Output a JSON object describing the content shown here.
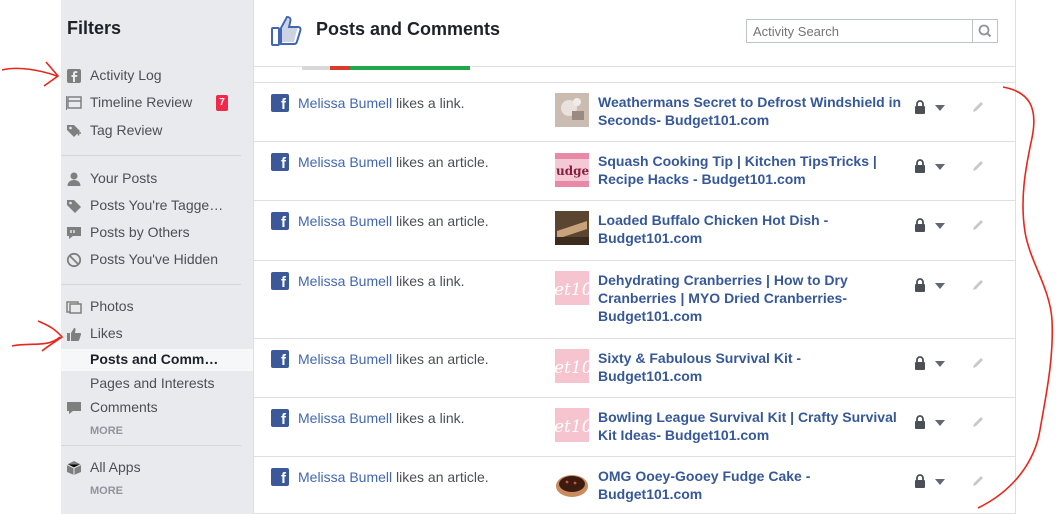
{
  "sidebar": {
    "title": "Filters",
    "groups": [
      [
        {
          "label": "Activity Log",
          "icon": "facebook-square-icon"
        },
        {
          "label": "Timeline Review",
          "icon": "timeline-review-icon",
          "badge": "7"
        },
        {
          "label": "Tag Review",
          "icon": "tag-review-icon"
        }
      ],
      [
        {
          "label": "Your Posts",
          "icon": "person-icon"
        },
        {
          "label": "Posts You're Tagged In",
          "icon": "tag-icon"
        },
        {
          "label": "Posts by Others",
          "icon": "speech-bubble-icon"
        },
        {
          "label": "Posts You've Hidden",
          "icon": "hidden-icon"
        }
      ],
      [
        {
          "label": "Photos",
          "icon": "photos-icon"
        },
        {
          "label": "Likes",
          "icon": "thumbs-up-icon"
        },
        {
          "label": "Posts and Comments",
          "selected": true
        },
        {
          "label": "Pages and Interests"
        },
        {
          "label": "Comments",
          "icon": "comment-icon"
        }
      ],
      [
        {
          "label": "All Apps",
          "icon": "cube-icon"
        }
      ]
    ],
    "more_label": "MORE"
  },
  "header": {
    "title": "Posts and Comments",
    "search_placeholder": "Activity Search"
  },
  "activity": [
    {
      "name": "Melissa Bumell",
      "action": " likes a link.",
      "title": "Weathermans Secret to Defrost Windshield in Seconds- Budget101.com",
      "thumb": "windshield"
    },
    {
      "name": "Melissa Bumell",
      "action": " likes an article.",
      "title": "Squash Cooking Tip | Kitchen TipsTricks | Recipe Hacks - Budget101.com",
      "thumb": "budget-logo"
    },
    {
      "name": "Melissa Bumell",
      "action": " likes an article.",
      "title": "Loaded Buffalo Chicken Hot Dish - Budget101.com",
      "thumb": "food"
    },
    {
      "name": "Melissa Bumell",
      "action": " likes a link.",
      "title": "Dehydrating Cranberries | How to Dry Cranberries | MYO Dried Cranberries- Budget101.com",
      "thumb": "pink-logo"
    },
    {
      "name": "Melissa Bumell",
      "action": " likes an article.",
      "title": "Sixty & Fabulous Survival Kit - Budget101.com",
      "thumb": "pink-logo"
    },
    {
      "name": "Melissa Bumell",
      "action": " likes a link.",
      "title": "Bowling League Survival Kit | Crafty Survival Kit Ideas- Budget101.com",
      "thumb": "pink-logo"
    },
    {
      "name": "Melissa Bumell",
      "action": " likes an article.",
      "title": "OMG Ooey-Gooey Fudge Cake - Budget101.com",
      "thumb": "cake"
    }
  ],
  "colors": {
    "link": "#4267b2",
    "title": "#365899",
    "annotation": "#e8261b",
    "badge": "#f02849"
  }
}
